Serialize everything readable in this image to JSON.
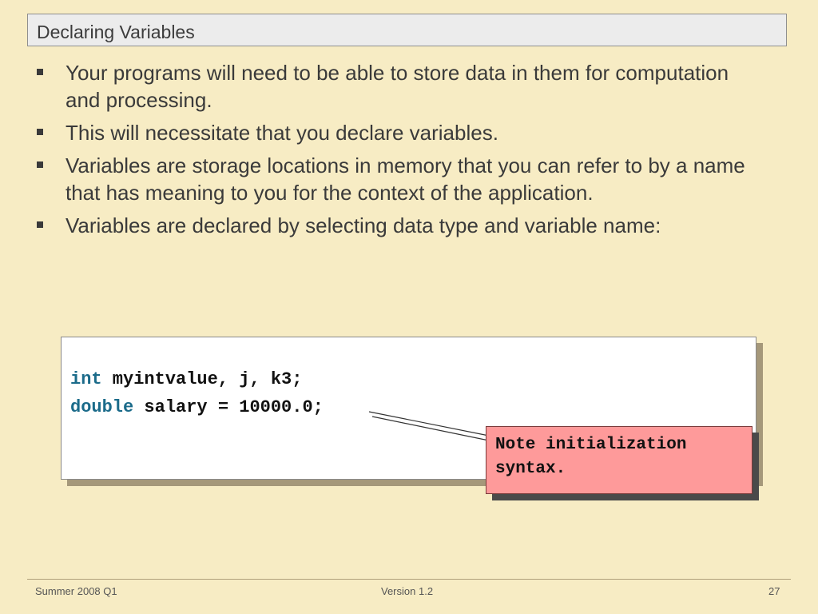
{
  "slide": {
    "title": "Declaring Variables",
    "bullets": [
      "Your programs will need to be able to store data in them for computation and processing.",
      "This will necessitate that you declare variables.",
      "Variables are storage locations in memory that you can refer to by a name that has meaning to you for the context of the application.",
      "Variables are declared by selecting data type and variable name:"
    ],
    "code": [
      {
        "keyword": "int",
        "rest": " myintvalue, j, k3;"
      },
      {
        "keyword": "double",
        "rest": " salary = 10000.0;"
      }
    ],
    "note": "Note initialization syntax."
  },
  "footer": {
    "left": "Summer 2008 Q1",
    "center": "Version 1.2",
    "right": "27"
  },
  "colors": {
    "background": "#f7ecc4",
    "keyword": "#1b6b8a",
    "note_fill": "#fe9a9a"
  }
}
